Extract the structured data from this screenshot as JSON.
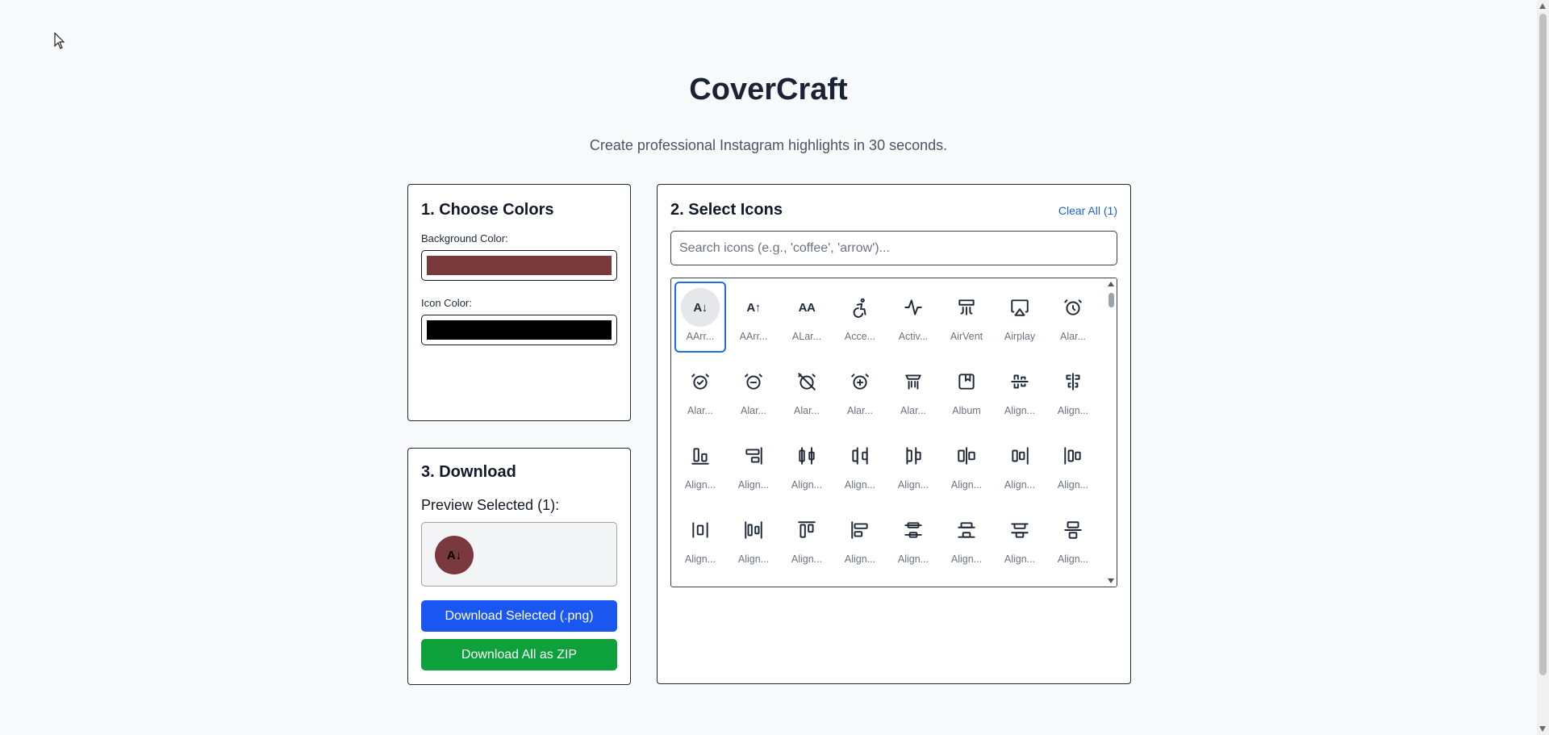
{
  "app": {
    "title": "CoverCraft",
    "subtitle": "Create professional Instagram highlights in 30 seconds."
  },
  "colors_card": {
    "heading": "1. Choose Colors",
    "background_label": "Background Color:",
    "background_color": "#7a3a3d",
    "icon_label": "Icon Color:",
    "icon_color": "#000000"
  },
  "icons_card": {
    "heading": "2. Select Icons",
    "clear_all": "Clear All (1)",
    "search_placeholder": "Search icons (e.g., 'coffee', 'arrow')...",
    "search_value": "",
    "selected_index": 0,
    "icons": [
      {
        "label": "AArr...",
        "icon": "a-arrow-down-icon"
      },
      {
        "label": "AArr...",
        "icon": "a-arrow-up-icon"
      },
      {
        "label": "ALar...",
        "icon": "a-large-small-icon"
      },
      {
        "label": "Acce...",
        "icon": "accessibility-icon"
      },
      {
        "label": "Activ...",
        "icon": "activity-icon"
      },
      {
        "label": "AirVent",
        "icon": "air-vent-icon"
      },
      {
        "label": "Airplay",
        "icon": "airplay-icon"
      },
      {
        "label": "Alar...",
        "icon": "alarm-clock-icon"
      },
      {
        "label": "Alar...",
        "icon": "alarm-clock-check-icon"
      },
      {
        "label": "Alar...",
        "icon": "alarm-clock-minus-icon"
      },
      {
        "label": "Alar...",
        "icon": "alarm-clock-off-icon"
      },
      {
        "label": "Alar...",
        "icon": "alarm-clock-plus-icon"
      },
      {
        "label": "Alar...",
        "icon": "alarm-smoke-icon"
      },
      {
        "label": "Album",
        "icon": "album-icon"
      },
      {
        "label": "Align...",
        "icon": "align-center-horizontal-icon"
      },
      {
        "label": "Align...",
        "icon": "align-center-vertical-icon"
      },
      {
        "label": "Align...",
        "icon": "align-end-horizontal-icon"
      },
      {
        "label": "Align...",
        "icon": "align-end-vertical-icon"
      },
      {
        "label": "Align...",
        "icon": "align-h-distribute-center-icon"
      },
      {
        "label": "Align...",
        "icon": "align-h-distribute-end-icon"
      },
      {
        "label": "Align...",
        "icon": "align-h-distribute-start-icon"
      },
      {
        "label": "Align...",
        "icon": "align-h-justify-center-icon"
      },
      {
        "label": "Align...",
        "icon": "align-h-justify-end-icon"
      },
      {
        "label": "Align...",
        "icon": "align-h-justify-start-icon"
      },
      {
        "label": "Align...",
        "icon": "align-h-space-around-icon"
      },
      {
        "label": "Align...",
        "icon": "align-h-space-between-icon"
      },
      {
        "label": "Align...",
        "icon": "align-start-horizontal-icon"
      },
      {
        "label": "Align...",
        "icon": "align-start-vertical-icon"
      },
      {
        "label": "Align...",
        "icon": "align-v-distribute-center-icon"
      },
      {
        "label": "Align...",
        "icon": "align-v-distribute-end-icon"
      },
      {
        "label": "Align...",
        "icon": "align-v-distribute-start-icon"
      },
      {
        "label": "Align...",
        "icon": "align-v-justify-center-icon"
      }
    ]
  },
  "download_card": {
    "heading": "3. Download",
    "preview_label": "Preview Selected (1):",
    "preview_glyph": "A↓",
    "btn_png": "Download Selected (.png)",
    "btn_zip": "Download All as ZIP"
  }
}
